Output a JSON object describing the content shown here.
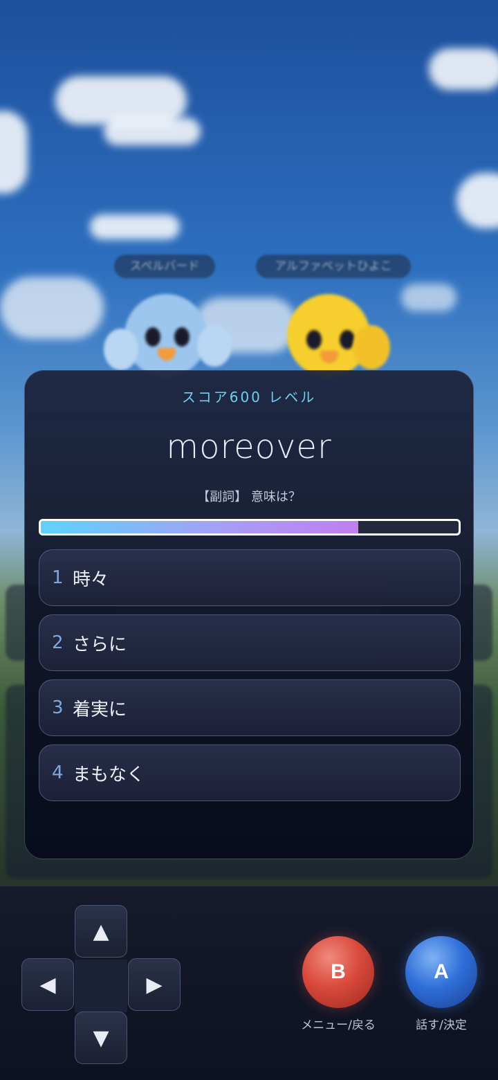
{
  "background": {
    "name_tags": [
      "スペルバード",
      "アルファベットひよこ"
    ]
  },
  "quiz": {
    "level_label": "スコア600 レベル",
    "word": "moreover",
    "prompt": "【副詞】 意味は？",
    "progress": 0.76,
    "choices": [
      {
        "number": "1",
        "text": "時々"
      },
      {
        "number": "2",
        "text": "さらに"
      },
      {
        "number": "3",
        "text": "着実に"
      },
      {
        "number": "4",
        "text": "まもなく"
      }
    ]
  },
  "controls": {
    "dpad": {
      "up": "▲",
      "left": "◀",
      "right": "▶",
      "down": "▼"
    },
    "b_button": {
      "label": "B",
      "caption": "メニュー/戻る",
      "color": "#d9493b"
    },
    "a_button": {
      "label": "A",
      "caption": "話す/決定",
      "color": "#2f6fd8"
    }
  }
}
